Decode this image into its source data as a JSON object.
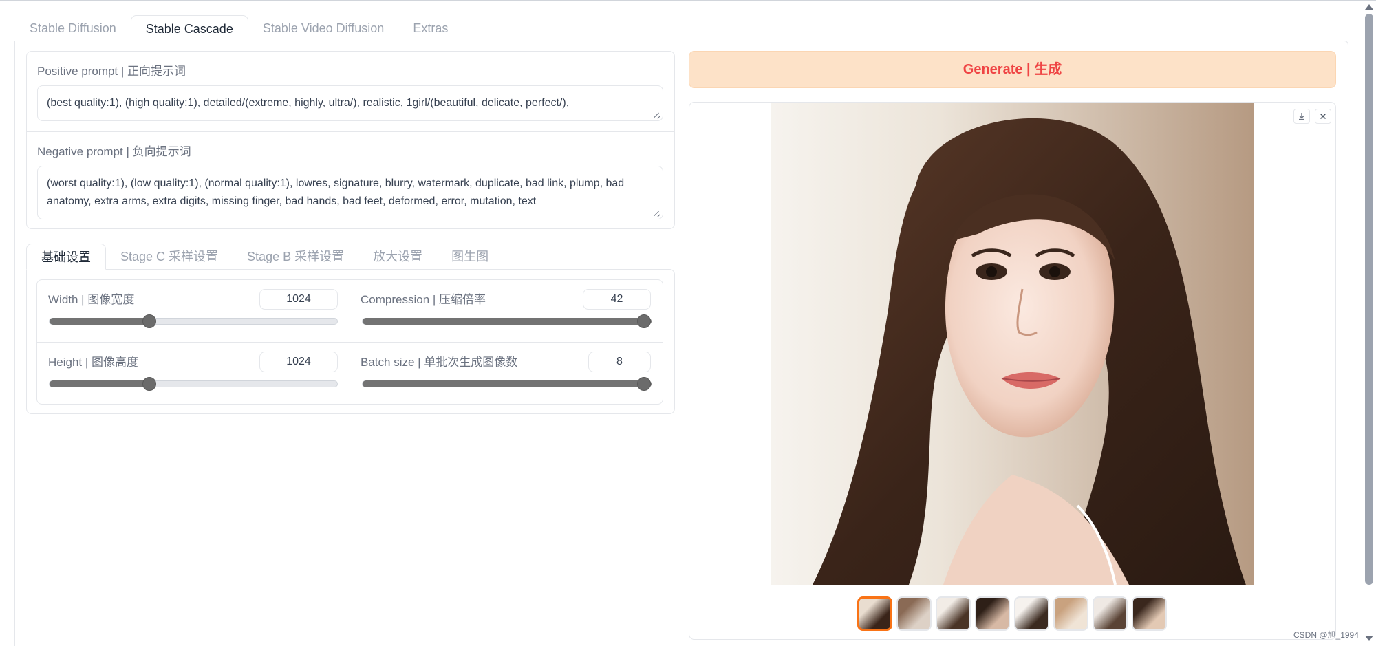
{
  "main_tabs": [
    "Stable Diffusion",
    "Stable Cascade",
    "Stable Video Diffusion",
    "Extras"
  ],
  "prompts": {
    "positive_label": "Positive prompt | 正向提示词",
    "positive_value": "(best quality:1), (high quality:1), detailed/(extreme, highly, ultra/), realistic, 1girl/(beautiful, delicate, perfect/),",
    "negative_label": "Negative prompt | 负向提示词",
    "negative_value": "(worst quality:1), (low quality:1), (normal quality:1), lowres, signature, blurry, watermark, duplicate, bad link, plump, bad anatomy, extra arms, extra digits, missing finger, bad hands, bad feet, deformed, error, mutation, text"
  },
  "settings_tabs": [
    "基础设置",
    "Stage C 采样设置",
    "Stage B 采样设置",
    "放大设置",
    "图生图"
  ],
  "settings": {
    "width": {
      "label": "Width | 图像宽度",
      "value": "1024",
      "fraction": 0.34
    },
    "compression": {
      "label": "Compression | 压缩倍率",
      "value": "42",
      "fraction": 1.0
    },
    "height": {
      "label": "Height | 图像高度",
      "value": "1024",
      "fraction": 0.34
    },
    "batch": {
      "label": "Batch size | 单批次生成图像数",
      "value": "8",
      "fraction": 1.0
    }
  },
  "generate": {
    "label_en": "Generate | ",
    "label_zh": "生成"
  },
  "gallery": {
    "download_icon": "download-icon",
    "close_icon": "close-icon",
    "thumbnail_count": 8,
    "selected_index": 0
  },
  "watermark": "CSDN @旭_1994",
  "colors": {
    "accent": "#f97316",
    "generate_bg": "#fde2c8",
    "generate_text": "#ef4444"
  }
}
